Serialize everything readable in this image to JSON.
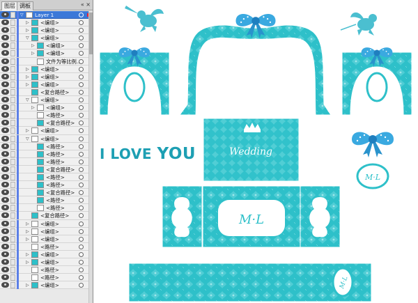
{
  "panel": {
    "tabs": [
      "图层",
      "调板"
    ],
    "controls": "« ×",
    "menu": "▸≡",
    "layers": [
      {
        "name": "Layer 1",
        "indent": 0,
        "expanded": true,
        "selected": true,
        "thumb": "white"
      },
      {
        "name": "<编组>",
        "indent": 1,
        "expanded": false,
        "thumb": "teal"
      },
      {
        "name": "<编组>",
        "indent": 1,
        "expanded": false,
        "thumb": "teal"
      },
      {
        "name": "<编组>",
        "indent": 1,
        "expanded": true,
        "thumb": "teal"
      },
      {
        "name": "<编组>",
        "indent": 2,
        "expanded": false,
        "thumb": "teal"
      },
      {
        "name": "<编组>",
        "indent": 2,
        "expanded": false,
        "thumb": "teal"
      },
      {
        "name": "文件为等比例...",
        "indent": 2,
        "expanded": null,
        "thumb": "white"
      },
      {
        "name": "<编组>",
        "indent": 1,
        "expanded": false,
        "thumb": "teal"
      },
      {
        "name": "<编组>",
        "indent": 1,
        "expanded": false,
        "thumb": "teal"
      },
      {
        "name": "<编组>",
        "indent": 1,
        "expanded": false,
        "thumb": "teal"
      },
      {
        "name": "<复合路径>",
        "indent": 1,
        "expanded": null,
        "thumb": "teal"
      },
      {
        "name": "<编组>",
        "indent": 1,
        "expanded": true,
        "thumb": "white"
      },
      {
        "name": "<编组>",
        "indent": 2,
        "expanded": false,
        "thumb": "white"
      },
      {
        "name": "<路径>",
        "indent": 2,
        "expanded": null,
        "thumb": "white"
      },
      {
        "name": "<复合路径>",
        "indent": 2,
        "expanded": null,
        "thumb": "teal"
      },
      {
        "name": "<编组>",
        "indent": 1,
        "expanded": false,
        "thumb": "white"
      },
      {
        "name": "<编组>",
        "indent": 1,
        "expanded": true,
        "thumb": "white"
      },
      {
        "name": "<路径>",
        "indent": 2,
        "expanded": null,
        "thumb": "teal"
      },
      {
        "name": "<路径>",
        "indent": 2,
        "expanded": null,
        "thumb": "teal"
      },
      {
        "name": "<路径>",
        "indent": 2,
        "expanded": null,
        "thumb": "teal"
      },
      {
        "name": "<复合路径>",
        "indent": 2,
        "expanded": null,
        "thumb": "teal"
      },
      {
        "name": "<路径>",
        "indent": 2,
        "expanded": null,
        "thumb": "teal"
      },
      {
        "name": "<路径>",
        "indent": 2,
        "expanded": null,
        "thumb": "teal"
      },
      {
        "name": "<复合路径>",
        "indent": 2,
        "expanded": null,
        "thumb": "teal"
      },
      {
        "name": "<路径>",
        "indent": 2,
        "expanded": null,
        "thumb": "teal"
      },
      {
        "name": "<路径>",
        "indent": 2,
        "expanded": null,
        "thumb": "white"
      },
      {
        "name": "<复合路径>",
        "indent": 1,
        "expanded": null,
        "thumb": "teal"
      },
      {
        "name": "<编组>",
        "indent": 1,
        "expanded": false,
        "thumb": "white"
      },
      {
        "name": "<编组>",
        "indent": 1,
        "expanded": false,
        "thumb": "white"
      },
      {
        "name": "<编组>",
        "indent": 1,
        "expanded": false,
        "thumb": "white"
      },
      {
        "name": "<路径>",
        "indent": 1,
        "expanded": null,
        "thumb": "white"
      },
      {
        "name": "<编组>",
        "indent": 1,
        "expanded": false,
        "thumb": "teal"
      },
      {
        "name": "<编组>",
        "indent": 1,
        "expanded": false,
        "thumb": "teal"
      },
      {
        "name": "<路径>",
        "indent": 1,
        "expanded": null,
        "thumb": "white"
      },
      {
        "name": "<路径>",
        "indent": 1,
        "expanded": null,
        "thumb": "white"
      },
      {
        "name": "<编组>",
        "indent": 1,
        "expanded": false,
        "thumb": "teal"
      }
    ]
  },
  "canvas": {
    "love_text_i": "I LOVE ",
    "love_text_you": "YOU",
    "wedding_text": "Wedding",
    "monogram": "M·L",
    "monogram_small": "M·L",
    "monogram_strip": "M·L",
    "colors": {
      "teal": "#2ec0c9",
      "teal_dark": "#1a9fb0",
      "bow": "#3aa9e0",
      "cupid": "#4bbfd0"
    }
  }
}
